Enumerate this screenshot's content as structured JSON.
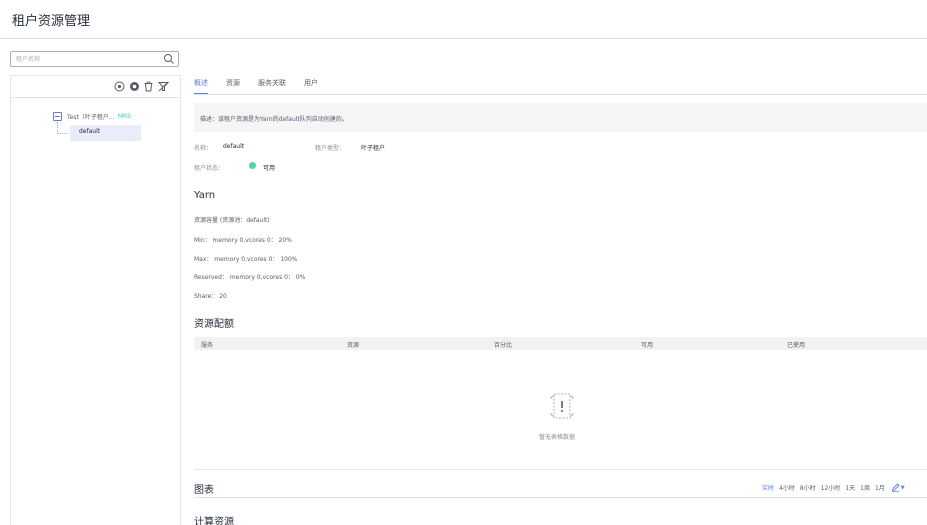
{
  "page": {
    "title": "租户资源管理"
  },
  "search": {
    "placeholder": "租户名称"
  },
  "toolbar": {
    "icons": [
      "add-circle-icon",
      "settings-icon",
      "delete-icon",
      "filter-off-icon"
    ]
  },
  "tree": {
    "root": {
      "label": "Test（叶子租户…",
      "badge": "MRS"
    },
    "child": {
      "label": "default"
    }
  },
  "tabs": [
    {
      "label": "概述",
      "active": true
    },
    {
      "label": "资源",
      "active": false
    },
    {
      "label": "服务关联",
      "active": false
    },
    {
      "label": "用户",
      "active": false
    }
  ],
  "overview": {
    "description": "描述：该租户资源是为Yarn的default队列自动创建的。",
    "name_label": "名称：",
    "name_value": "default",
    "type_label": "租户类型：",
    "type_value": "叶子租户",
    "status_label": "租户状态：",
    "status_value": "可用",
    "status_color": "#50d4ab"
  },
  "yarn": {
    "title": "Yarn",
    "capacity": "资源容量 (资源池：default)",
    "min": "Min： memory 0,vcores 0： 20%",
    "max": "Max： memory 0,vcores 0： 100%",
    "reserved": "Reserved： memory 0,vcores 0： 0%",
    "share": "Share： 20"
  },
  "quota": {
    "title": "资源配额",
    "columns": [
      "服务",
      "资源",
      "百分比",
      "可用",
      "已使用"
    ],
    "empty_text": "暂无表格数据"
  },
  "chart": {
    "title": "图表",
    "time_ranges": [
      {
        "label": "实时",
        "active": true
      },
      {
        "label": "4小时",
        "active": false
      },
      {
        "label": "8小时",
        "active": false
      },
      {
        "label": "12小时",
        "active": false
      },
      {
        "label": "1天",
        "active": false
      },
      {
        "label": "1周",
        "active": false
      },
      {
        "label": "1月",
        "active": false
      }
    ],
    "compute_title": "计算资源"
  },
  "colors": {
    "accent": "#5e7ce0",
    "success": "#50d4ab"
  }
}
